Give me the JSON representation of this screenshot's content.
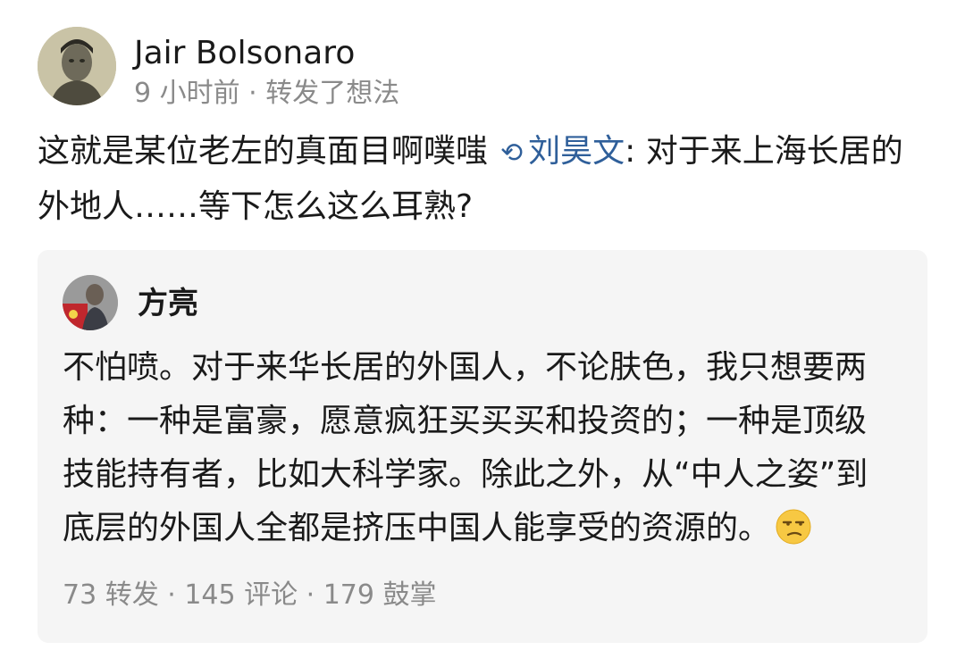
{
  "post": {
    "author": "Jair Bolsonaro",
    "meta": "9 小时前 · 转发了想法",
    "text": "这就是某位老左的真面目啊噗嗤",
    "repost_icon": "repost-icon",
    "mention": "刘昊文",
    "quoted_text": ": 对于来上海长居的外地人……等下怎么这么耳熟?"
  },
  "quote": {
    "author": "方亮",
    "text": "不怕喷。对于来华长居的外国人，不论肤色，我只想要两种：一种是富豪，愿意疯狂买买买和投资的；一种是顶级技能持有者，比如大科学家。除此之外，从“中人之姿”到底层的外国人全都是挤压中国人能享受的资源的。",
    "emoji": "unamused-face-emoji",
    "stats": "73 转发 · 145 评论 · 179 鼓掌"
  },
  "colors": {
    "link": "#2f5f9a",
    "meta": "#8a8a8a",
    "card_bg": "#f5f5f5"
  }
}
